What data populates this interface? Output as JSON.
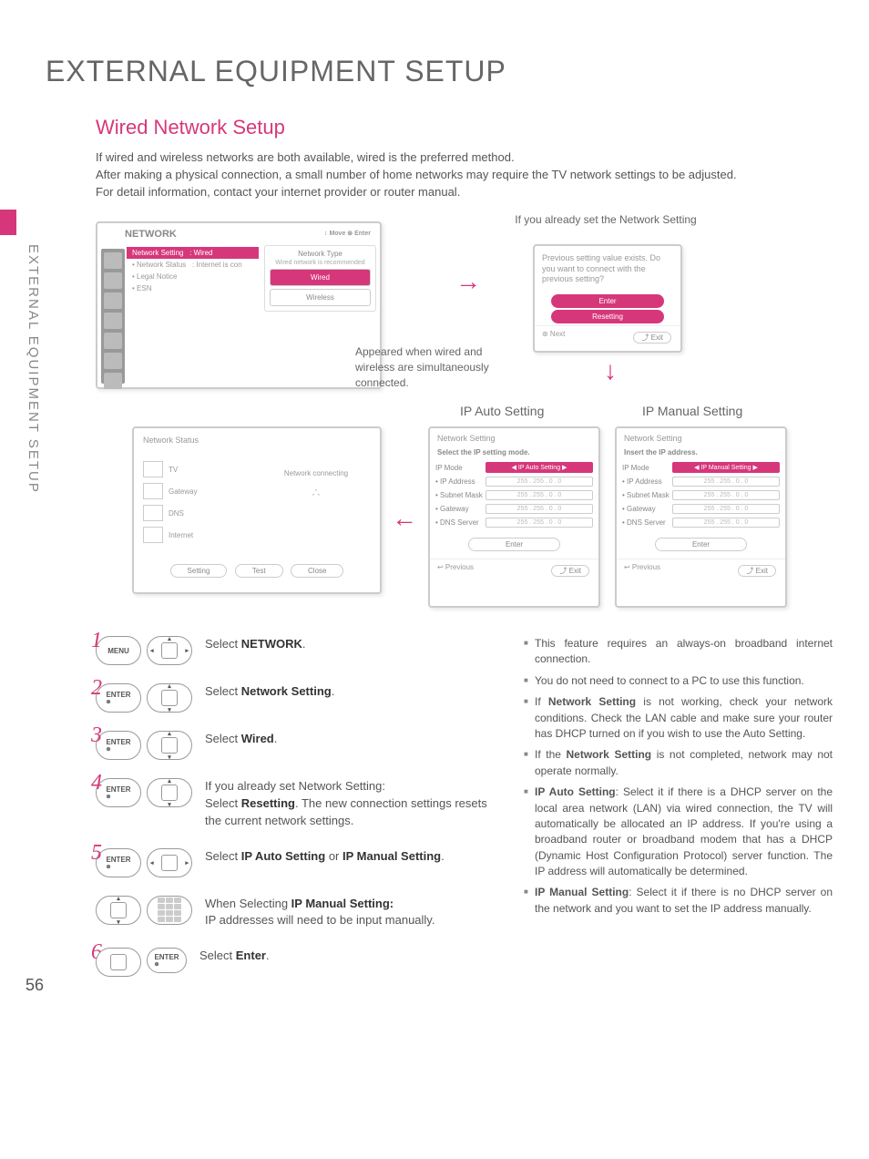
{
  "page_number": "56",
  "side_label": "EXTERNAL EQUIPMENT SETUP",
  "h1": "EXTERNAL EQUIPMENT SETUP",
  "h2": "Wired Network Setup",
  "intro": {
    "p1": "If wired and wireless networks are both available, wired is the preferred method.",
    "p2": "After making a physical connection, a small number of home networks may require the TV network settings to be adjusted.",
    "p3": "For detail information, contact your internet provider or router manual."
  },
  "labels": {
    "already_set": "If you already set the Network Setting",
    "appeared": "Appeared when wired and wireless are simultaneously connected.",
    "ip_auto": "IP Auto Setting",
    "ip_manual": "IP Manual Setting"
  },
  "panels": {
    "network": {
      "title": "NETWORK",
      "hints": "↕ Move  ⊛ Enter",
      "items": [
        {
          "l": "Network Setting",
          "r": ": Wired",
          "sel": true
        },
        {
          "l": "Network Status",
          "r": ": Internet is con"
        },
        {
          "l": "Legal Notice",
          "r": ""
        },
        {
          "l": "ESN",
          "r": ""
        }
      ],
      "side_title": "Network Type",
      "side_sub": "Wired network is recommended",
      "opts": [
        "Wired",
        "Wireless"
      ]
    },
    "confirm": {
      "msg": "Previous setting value exists. Do you want to connect with the previous setting?",
      "b1": "Enter",
      "b2": "Resetting",
      "foot_l": "⊛ Next",
      "foot_r": "⤴ Exit"
    },
    "netstat": {
      "title": "Network Status",
      "tv": "TV",
      "gw": "Gateway",
      "dns": "DNS",
      "int": "Internet",
      "nc": "Network connecting",
      "b1": "Setting",
      "b2": "Test",
      "b3": "Close"
    },
    "ipset": {
      "title": "Network Setting",
      "auto_msg": "Select the IP setting mode.",
      "manual_msg": "Insert the IP address.",
      "mode": "IP Mode",
      "auto_mode": "◀ IP Auto Setting ▶",
      "manual_mode": "◀ IP Manual Setting ▶",
      "rows": [
        "IP Address",
        "Subnet Mask",
        "Gateway",
        "DNS Server"
      ],
      "val": "255 . 255 . 0 . 0",
      "enter": "Enter",
      "foot_l": "↩ Previous",
      "foot_r": "⤴ Exit"
    }
  },
  "steps": {
    "s1": {
      "btn": "MENU",
      "t1": "Select ",
      "b": "NETWORK",
      "t2": "."
    },
    "s2": {
      "btn": "ENTER",
      "t1": "Select ",
      "b": "Network Setting",
      "t2": "."
    },
    "s3": {
      "btn": "ENTER",
      "t1": "Select ",
      "b": "Wired",
      "t2": "."
    },
    "s4": {
      "btn": "ENTER",
      "pre": "If you already set Network Setting:",
      "t1": "Select ",
      "b": "Resetting",
      "t2": ". The new connection settings resets the current network settings."
    },
    "s5": {
      "btn": "ENTER",
      "t1": "Select ",
      "b": "IP Auto Setting",
      "mid": " or ",
      "b2": "IP Manual Setting",
      "t2": "."
    },
    "s5b": {
      "pre": "When Selecting ",
      "b": "IP Manual Setting:",
      "t": "IP addresses will need to be input manually."
    },
    "s6": {
      "btn": "ENTER",
      "t1": "Select ",
      "b": "Enter",
      "t2": "."
    }
  },
  "notes": {
    "n1": "This feature requires an always-on broadband internet connection.",
    "n2": "You do not need to connect to a PC to use this function.",
    "n3_a": "If ",
    "n3_b": "Network Setting",
    "n3_c": " is not working, check your network conditions. Check the LAN cable and make sure your router has DHCP turned on if you wish to use the Auto Setting.",
    "n4_a": "If the ",
    "n4_b": "Network Setting",
    "n4_c": " is not completed, network may not operate normally.",
    "n5_b": "IP Auto Setting",
    "n5_c": ": Select it if there is a DHCP server on the local area network (LAN) via wired connection, the TV will automatically be allocated an IP address. If you're using a broadband router or broadband modem that has a DHCP (Dynamic Host Configuration Protocol) server function. The IP address will automatically be determined.",
    "n6_b": "IP Manual Setting",
    "n6_c": ": Select it if there is no DHCP server on the network and you want to set the IP address manually."
  }
}
